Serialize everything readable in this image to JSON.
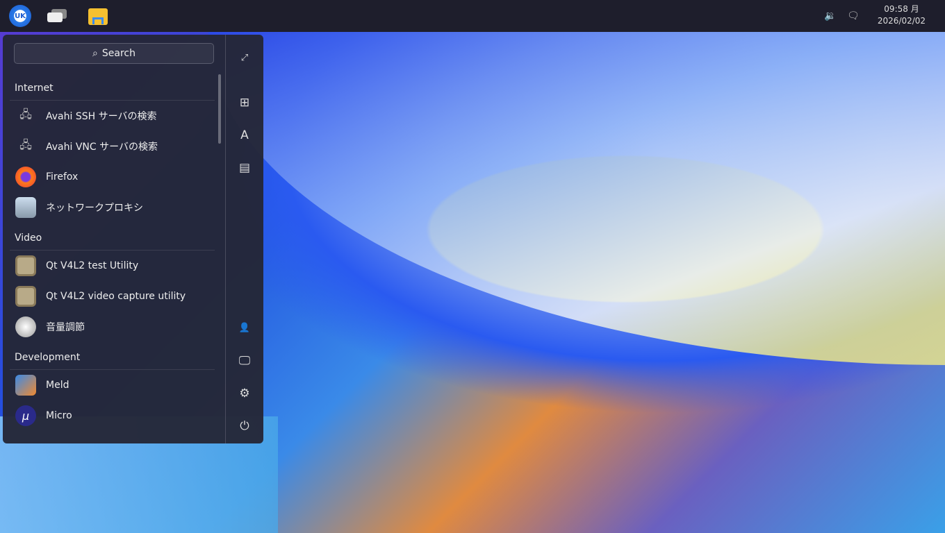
{
  "taskbar": {
    "start_label": "UK",
    "clock_time": "09:58 月",
    "clock_date": "2026/02/02"
  },
  "menu": {
    "search_placeholder": "Search",
    "categories": [
      {
        "title": "Internet",
        "items": [
          {
            "label": "Avahi SSH サーバの検索",
            "icon": "network-monitor-icon"
          },
          {
            "label": "Avahi VNC サーバの検索",
            "icon": "network-monitor-icon"
          },
          {
            "label": "Firefox",
            "icon": "firefox-icon"
          },
          {
            "label": "ネットワークプロキシ",
            "icon": "proxy-icon"
          }
        ]
      },
      {
        "title": "Video",
        "items": [
          {
            "label": "Qt V4L2 test Utility",
            "icon": "video-icon"
          },
          {
            "label": "Qt V4L2 video capture utility",
            "icon": "video-icon"
          },
          {
            "label": "音量調節",
            "icon": "volume-knob-icon"
          }
        ]
      },
      {
        "title": "Development",
        "items": [
          {
            "label": "Meld",
            "icon": "meld-icon"
          },
          {
            "label": "Micro",
            "icon": "micro-icon"
          }
        ]
      }
    ]
  },
  "colors": {
    "taskbar": "#1e1e2c",
    "menu": "#242636"
  }
}
